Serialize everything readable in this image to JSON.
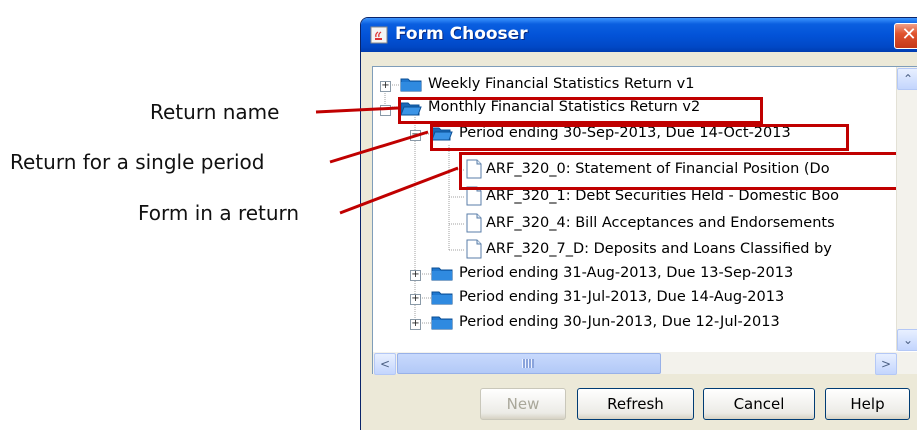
{
  "annotations": {
    "return_name": "Return name",
    "single_period": "Return for a single period",
    "form_in_return": "Form in a return"
  },
  "window": {
    "title": "Form Chooser",
    "close_glyph": "✕",
    "title_icon": "java-cup-icon"
  },
  "tree": {
    "items": [
      {
        "label": "Weekly Financial Statistics Return v1",
        "icon": "folder-icon",
        "expander": "+"
      },
      {
        "label": "Monthly Financial Statistics Return v2",
        "icon": "folder-open-icon",
        "expander": "−"
      },
      {
        "label": "Period ending 30-Sep-2013, Due 14-Oct-2013",
        "icon": "folder-open-icon",
        "expander": "−"
      },
      {
        "label": "ARF_320_0: Statement of Financial Position (Do",
        "icon": "document-icon"
      },
      {
        "label": "ARF_320_1: Debt Securities Held - Domestic Boo",
        "icon": "document-icon"
      },
      {
        "label": "ARF_320_4: Bill Acceptances and Endorsements",
        "icon": "document-icon"
      },
      {
        "label": "ARF_320_7_D: Deposits and Loans Classified by",
        "icon": "document-icon"
      },
      {
        "label": "Period ending 31-Aug-2013, Due 13-Sep-2013",
        "icon": "folder-icon",
        "expander": "+"
      },
      {
        "label": "Period ending 31-Jul-2013, Due 14-Aug-2013",
        "icon": "folder-icon",
        "expander": "+"
      },
      {
        "label": "Period ending 30-Jun-2013, Due 12-Jul-2013",
        "icon": "folder-icon",
        "expander": "+"
      }
    ]
  },
  "scroll": {
    "up": "⌃",
    "down": "⌄",
    "left": "<",
    "right": ">"
  },
  "buttons": {
    "new": "New",
    "refresh": "Refresh",
    "cancel": "Cancel",
    "help": "Help"
  },
  "colors": {
    "highlight_box": "#c00000",
    "titlebar": "#0353d8",
    "folder": "#2a7fd4"
  }
}
